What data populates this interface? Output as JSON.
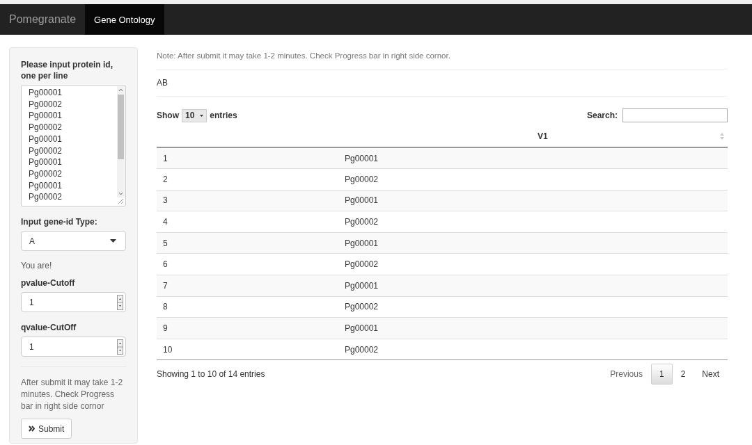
{
  "navbar": {
    "brand": "Pomegranate",
    "tabs": [
      {
        "label": "Gene Ontology",
        "selected": true
      }
    ]
  },
  "sidebar": {
    "protein_label": "Please input protein id, one per line",
    "protein_ids": [
      "Pg00001",
      "Pg00002",
      "Pg00001",
      "Pg00002",
      "Pg00001",
      "Pg00002",
      "Pg00001",
      "Pg00002",
      "Pg00001",
      "Pg00002"
    ],
    "gene_type_label": "Input gene-id Type:",
    "gene_type_value": "A",
    "message": "You are!",
    "cutoffs": [
      {
        "label": "pvalue-Cutoff",
        "value": "1"
      },
      {
        "label": "qvalue-CutOff",
        "value": "1"
      }
    ],
    "note": "After submit it may take 1-2 minutes. Check Progress bar in right side cornor",
    "submit": "Submit"
  },
  "main": {
    "note": "Note: After submit it may take 1-2 minutes. Check Progress bar in right side cornor.",
    "output": "AB",
    "table": {
      "show_label": "Show",
      "length_value": "10",
      "entries_label": "entries",
      "search_label": "Search:",
      "header": "V1",
      "rows": [
        [
          "1",
          "Pg00001"
        ],
        [
          "2",
          "Pg00002"
        ],
        [
          "3",
          "Pg00001"
        ],
        [
          "4",
          "Pg00002"
        ],
        [
          "5",
          "Pg00001"
        ],
        [
          "6",
          "Pg00002"
        ],
        [
          "7",
          "Pg00001"
        ],
        [
          "8",
          "Pg00002"
        ],
        [
          "9",
          "Pg00001"
        ],
        [
          "10",
          "Pg00002"
        ]
      ],
      "info": "Showing 1 to 10 of 14 entries",
      "pagination": [
        {
          "label": "Previous",
          "selected": false,
          "disabled": true
        },
        {
          "label": "1",
          "selected": true,
          "disabled": false
        },
        {
          "label": "2",
          "selected": false,
          "disabled": false
        },
        {
          "label": "Next",
          "selected": false,
          "disabled": false
        }
      ]
    }
  }
}
